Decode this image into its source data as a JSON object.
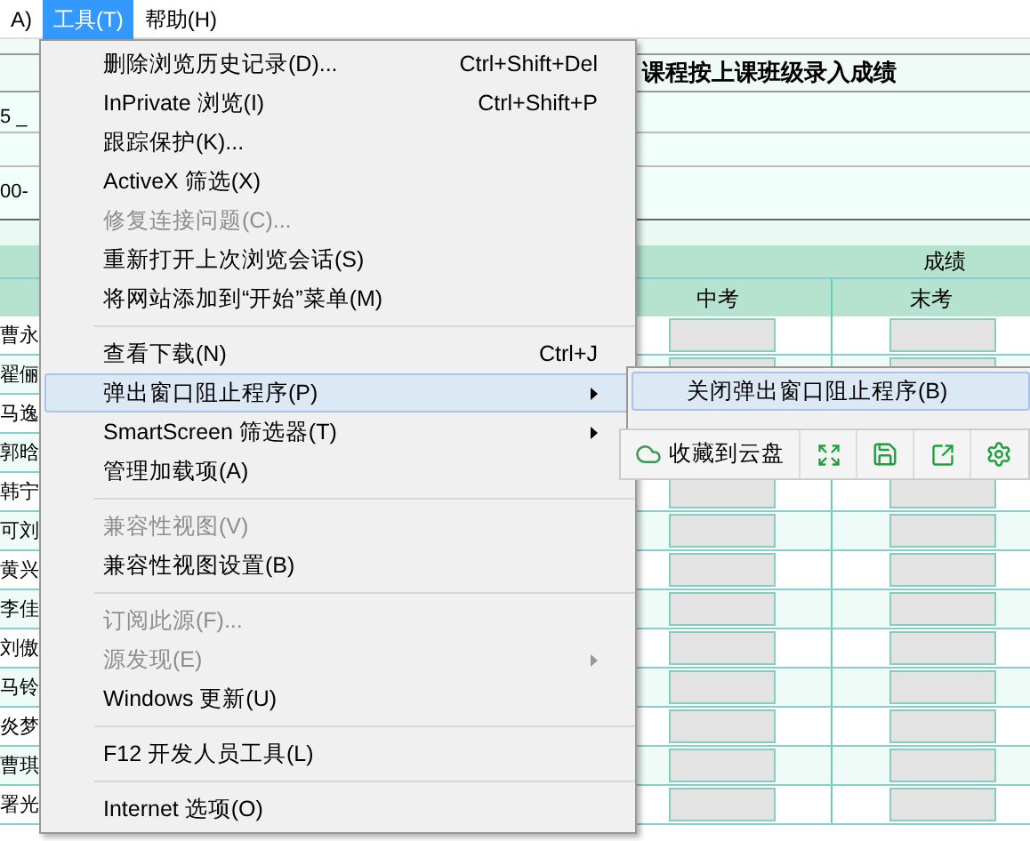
{
  "menubar": [
    {
      "label": "A)",
      "selected": false
    },
    {
      "label": "工具(T)",
      "selected": true
    },
    {
      "label": "帮助(H)",
      "selected": false
    }
  ],
  "page": {
    "title": "课程按上课班级录入成绩",
    "field_fragment": "5 _",
    "code_fragment": "00-",
    "group_header": "成绩",
    "columns": [
      "中考",
      "末考"
    ],
    "names": [
      "曹永",
      "翟俪",
      "马逸",
      "郭晗",
      "韩宁",
      "可刘",
      "黄兴",
      "李佳",
      "刘傲",
      "马铃",
      "炎梦",
      "曹琪",
      "署光"
    ]
  },
  "tools_menu": {
    "items": [
      {
        "kind": "item",
        "label": "删除浏览历史记录(D)...",
        "shortcut": "Ctrl+Shift+Del",
        "disabled": false,
        "submenu": false,
        "selected": false
      },
      {
        "kind": "item",
        "label": "InPrivate 浏览(I)",
        "shortcut": "Ctrl+Shift+P",
        "disabled": false,
        "submenu": false,
        "selected": false
      },
      {
        "kind": "item",
        "label": "跟踪保护(K)...",
        "disabled": false,
        "submenu": false,
        "selected": false
      },
      {
        "kind": "item",
        "label": "ActiveX 筛选(X)",
        "disabled": false,
        "submenu": false,
        "selected": false
      },
      {
        "kind": "item",
        "label": "修复连接问题(C)...",
        "disabled": true,
        "submenu": false,
        "selected": false
      },
      {
        "kind": "item",
        "label": "重新打开上次浏览会话(S)",
        "disabled": false,
        "submenu": false,
        "selected": false
      },
      {
        "kind": "item",
        "label": "将网站添加到“开始”菜单(M)",
        "disabled": false,
        "submenu": false,
        "selected": false
      },
      {
        "kind": "separator"
      },
      {
        "kind": "item",
        "label": "查看下载(N)",
        "shortcut": "Ctrl+J",
        "disabled": false,
        "submenu": false,
        "selected": false
      },
      {
        "kind": "item",
        "label": "弹出窗口阻止程序(P)",
        "disabled": false,
        "submenu": true,
        "selected": true
      },
      {
        "kind": "item",
        "label": "SmartScreen 筛选器(T)",
        "disabled": false,
        "submenu": true,
        "selected": false
      },
      {
        "kind": "item",
        "label": "管理加载项(A)",
        "disabled": false,
        "submenu": false,
        "selected": false
      },
      {
        "kind": "separator"
      },
      {
        "kind": "item",
        "label": "兼容性视图(V)",
        "disabled": true,
        "submenu": false,
        "selected": false
      },
      {
        "kind": "item",
        "label": "兼容性视图设置(B)",
        "disabled": false,
        "submenu": false,
        "selected": false
      },
      {
        "kind": "separator"
      },
      {
        "kind": "item",
        "label": "订阅此源(F)...",
        "disabled": true,
        "submenu": false,
        "selected": false
      },
      {
        "kind": "item",
        "label": "源发现(E)",
        "disabled": true,
        "submenu": true,
        "selected": false
      },
      {
        "kind": "item",
        "label": "Windows 更新(U)",
        "disabled": false,
        "submenu": false,
        "selected": false
      },
      {
        "kind": "separator"
      },
      {
        "kind": "item",
        "label": "F12 开发人员工具(L)",
        "disabled": false,
        "submenu": false,
        "selected": false
      },
      {
        "kind": "separator"
      },
      {
        "kind": "item",
        "label": "Internet 选项(O)",
        "disabled": false,
        "submenu": false,
        "selected": false
      }
    ]
  },
  "popup_submenu": {
    "items": [
      {
        "label": "关闭弹出窗口阻止程序(B)",
        "selected": true
      }
    ]
  },
  "toolbar": {
    "save_to_cloud": "收藏到云盘"
  }
}
